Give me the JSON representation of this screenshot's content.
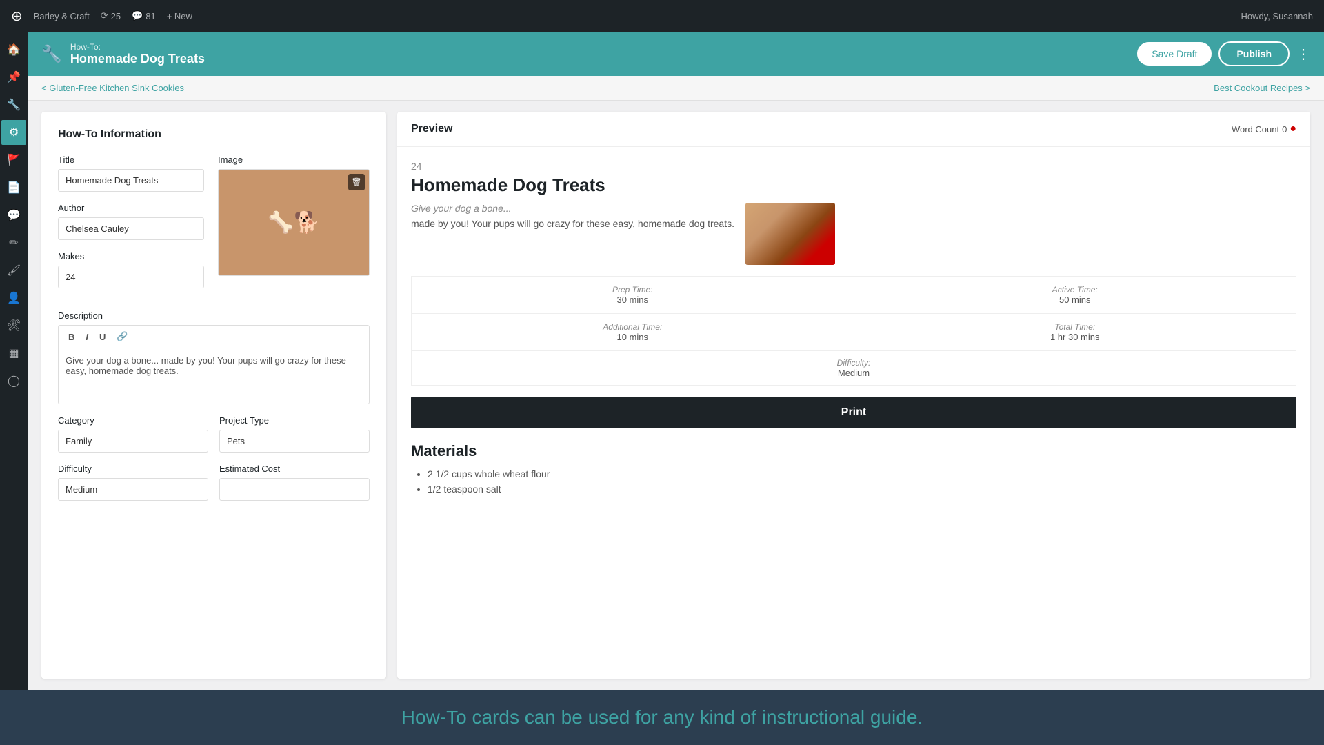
{
  "adminBar": {
    "site": "Barley & Craft",
    "updates": "25",
    "comments": "81",
    "new_label": "+ New",
    "user": "Howdy, Susannah"
  },
  "postHeader": {
    "type": "How-To:",
    "title": "Homemade Dog Treats",
    "save_draft": "Save Draft",
    "publish": "Publish"
  },
  "navigation": {
    "prev": "< Gluten-Free Kitchen Sink Cookies",
    "next": "Best Cookout Recipes >"
  },
  "form": {
    "section_title": "How-To Information",
    "title_label": "Title",
    "title_value": "Homemade Dog Treats",
    "author_label": "Author",
    "author_value": "Chelsea Cauley",
    "makes_label": "Makes",
    "makes_value": "24",
    "image_label": "Image",
    "description_label": "Description",
    "description_value": "Give your dog a bone... made by you! Your pups will go crazy for these easy, homemade dog treats.",
    "category_label": "Category",
    "category_value": "Family",
    "project_type_label": "Project Type",
    "project_type_value": "Pets",
    "difficulty_label": "Difficulty",
    "difficulty_value": "Medium",
    "estimated_cost_label": "Estimated Cost",
    "estimated_cost_value": ""
  },
  "preview": {
    "title": "Preview",
    "word_count_label": "Word Count",
    "word_count": "0",
    "recipe_number": "24",
    "recipe_name": "Homemade Dog Treats",
    "recipe_teaser": "Give your dog a bone...",
    "recipe_description": "made by you! Your pups will go crazy for these easy, homemade dog treats.",
    "prep_time_label": "Prep Time:",
    "prep_time": "30 mins",
    "active_time_label": "Active Time:",
    "active_time": "50 mins",
    "additional_time_label": "Additional Time:",
    "additional_time": "10 mins",
    "total_time_label": "Total Time:",
    "total_time": "1 hr 30 mins",
    "difficulty_label": "Difficulty:",
    "difficulty": "Medium",
    "print_label": "Print",
    "materials_title": "Materials",
    "materials": [
      "2 1/2 cups whole wheat flour",
      "1/2 teaspoon salt"
    ]
  },
  "caption": {
    "text": "How-To cards can be used for any kind of instructional guide."
  },
  "toolbar": {
    "bold": "B",
    "italic": "I",
    "underline": "U",
    "link": "🔗"
  }
}
